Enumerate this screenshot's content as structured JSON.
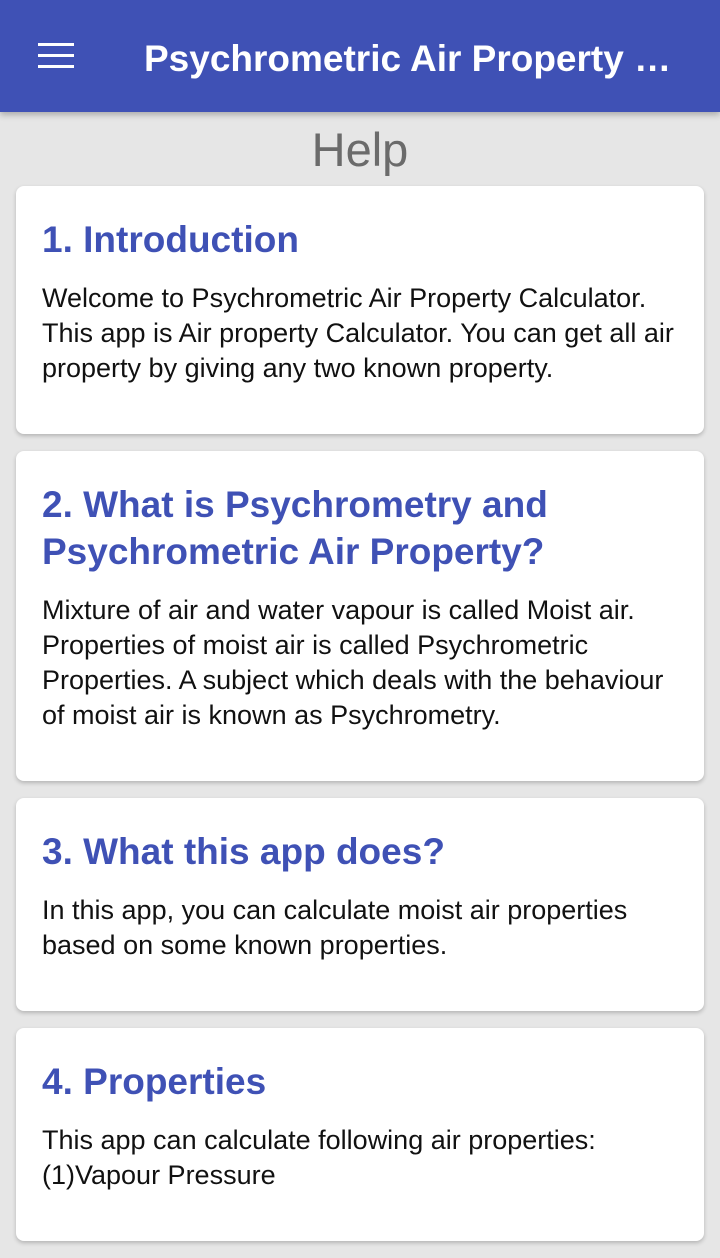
{
  "appbar": {
    "menu_icon": "hamburger-menu-icon",
    "title": "Psychrometric Air Property Calculator",
    "color": "#3f51b5"
  },
  "page": {
    "heading": "Help"
  },
  "sections": [
    {
      "title": "1. Introduction",
      "body": "Welcome to Psychrometric Air Property Calculator. This app is Air property Calculator. You can get all air property by giving any two known property."
    },
    {
      "title": "2. What is Psychrometry and Psychrometric Air Property?",
      "body": "Mixture of air and water vapour is called Moist air. Properties of moist air is called Psychrometric Properties. A subject which deals with the behaviour of moist air is known as Psychrometry."
    },
    {
      "title": "3. What this app does?",
      "body": "In this app, you can calculate moist air properties based on some known properties."
    },
    {
      "title": "4. Properties",
      "body": "This app can calculate following air properties:\n(1)Vapour Pressure"
    }
  ]
}
